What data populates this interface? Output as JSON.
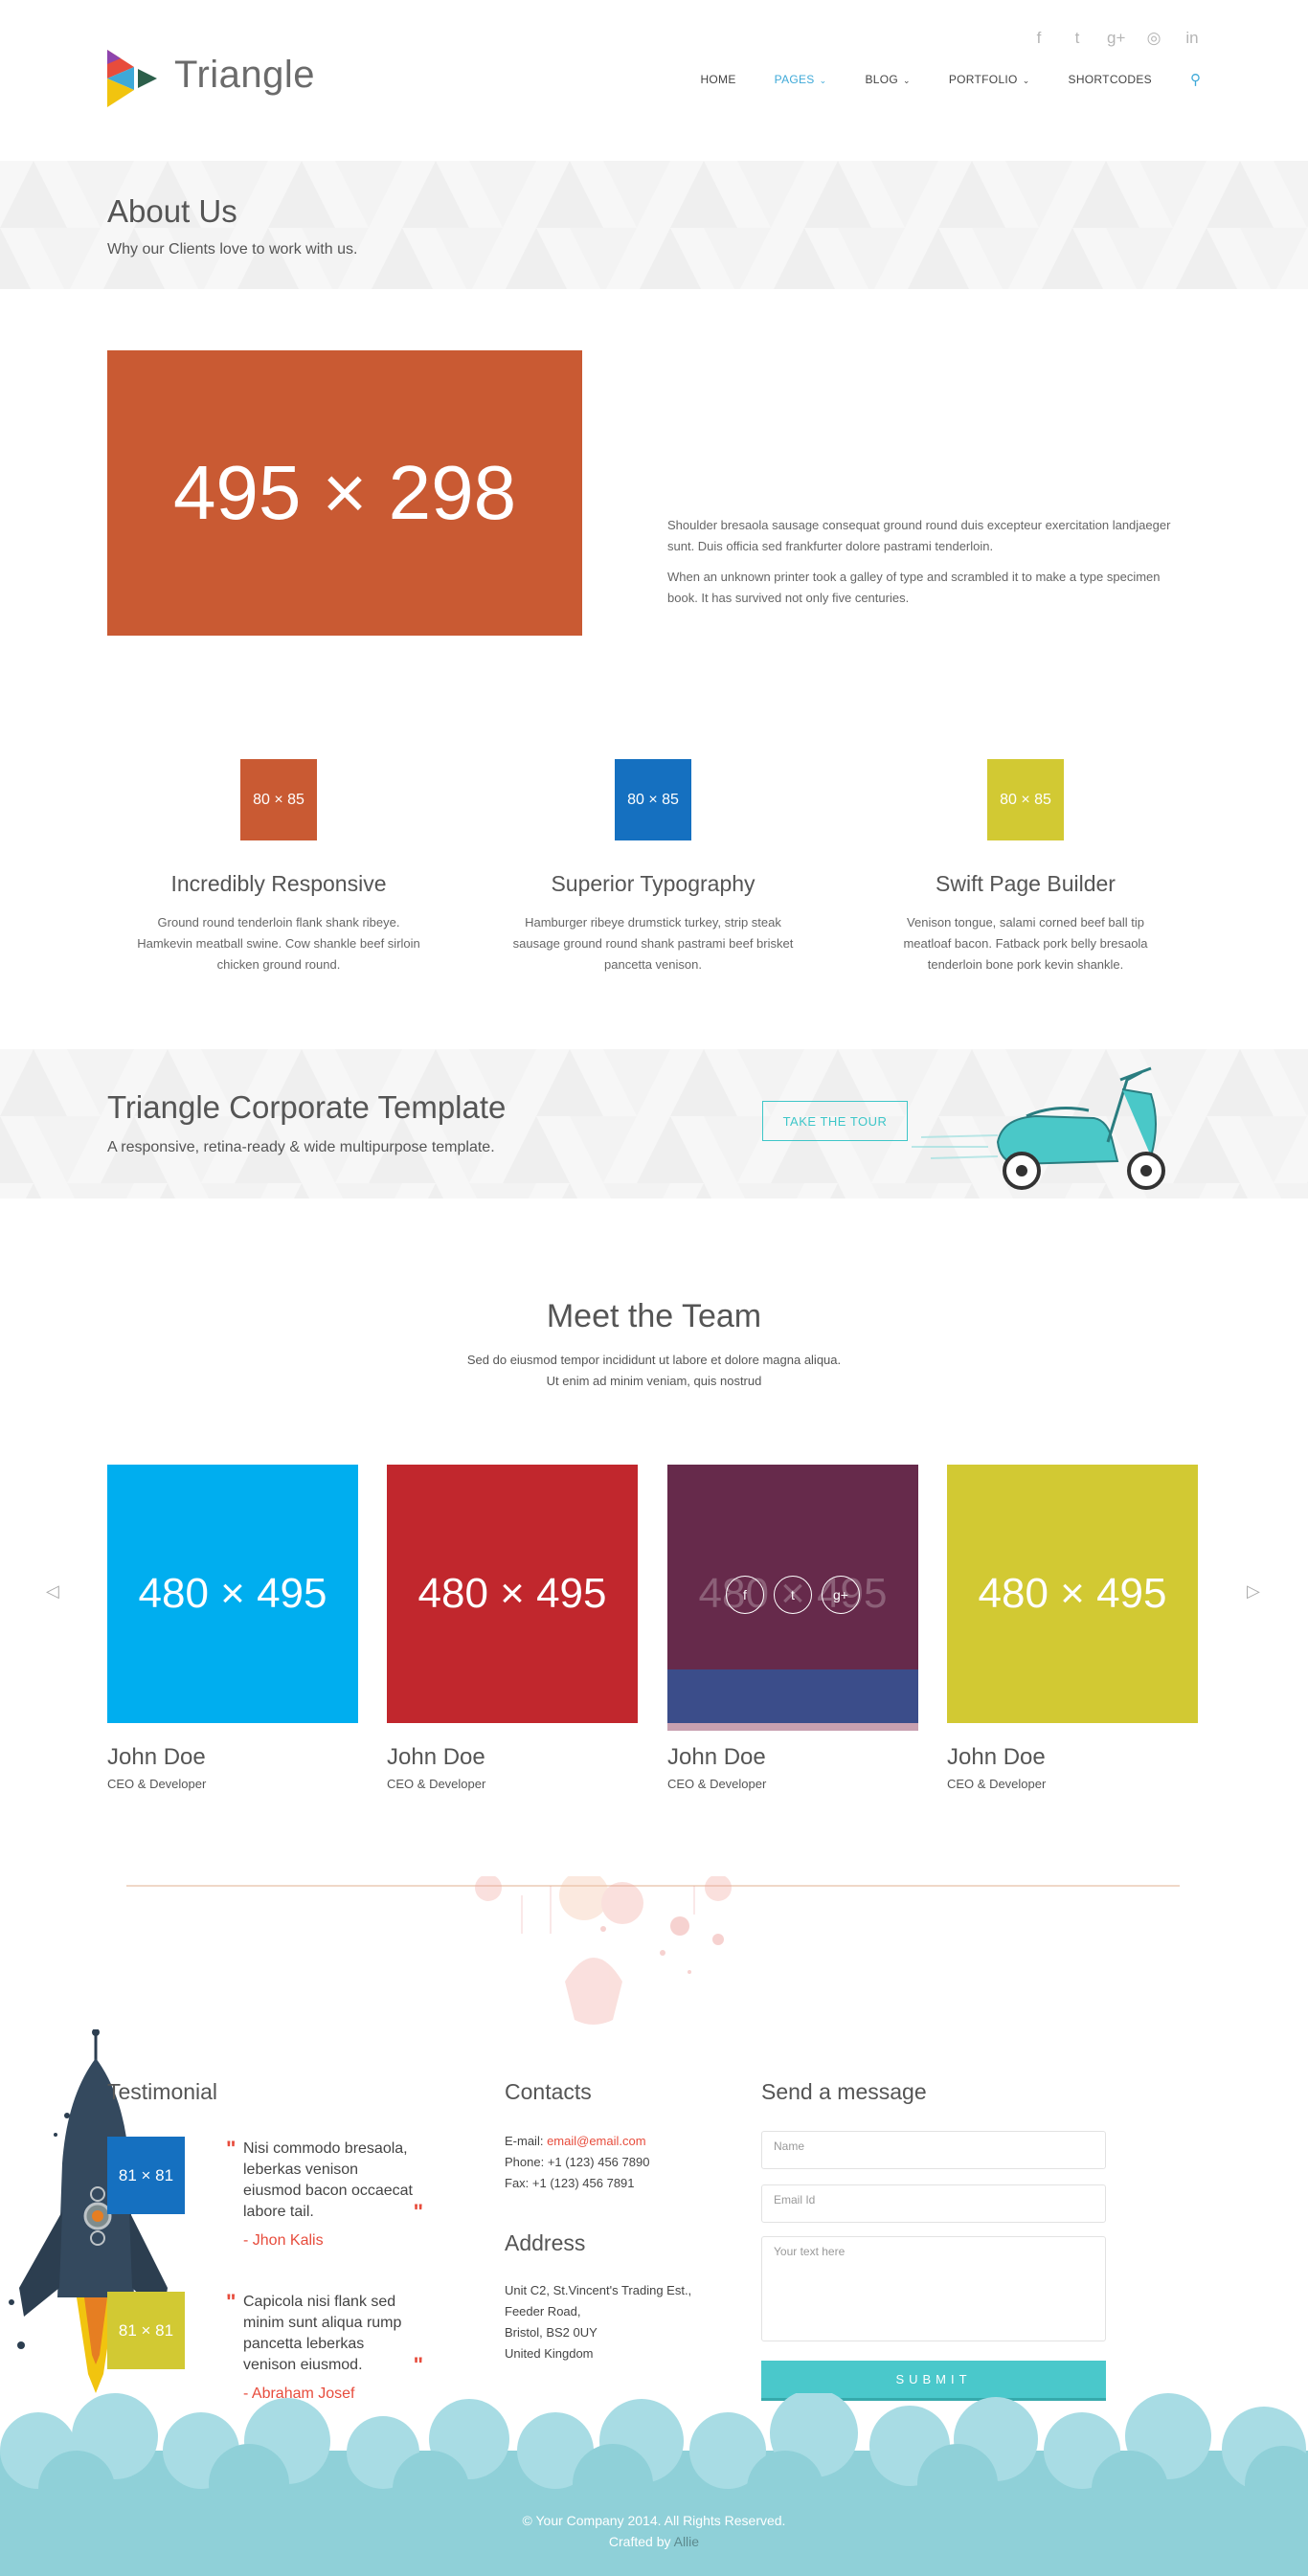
{
  "header": {
    "logo_text": "Triangle",
    "social_icons": [
      "facebook-icon",
      "twitter-icon",
      "google-plus-icon",
      "dribbble-icon",
      "linkedin-icon"
    ],
    "social_glyphs": [
      "f",
      "t",
      "g+",
      "◎",
      "in"
    ],
    "nav": [
      {
        "label": "HOME",
        "active": false,
        "caret": false
      },
      {
        "label": "PAGES",
        "active": true,
        "caret": true
      },
      {
        "label": "BLOG",
        "active": false,
        "caret": true
      },
      {
        "label": "PORTFOLIO",
        "active": false,
        "caret": true
      },
      {
        "label": "SHORTCODES",
        "active": false,
        "caret": false
      }
    ],
    "caret_glyph": "⌄",
    "search_glyph": "⚲"
  },
  "about": {
    "title": "About Us",
    "subtitle": "Why our Clients love to work with us.",
    "image_label": "495 × 298",
    "paragraphs": [
      "Shoulder bresaola sausage consequat ground round duis excepteur exercitation landjaeger sunt. Duis officia sed frankfurter dolore pastrami tenderloin.",
      "When an unknown printer took a galley of type and scrambled it to make a type specimen book. It has survived not only five centuries."
    ]
  },
  "features": [
    {
      "image_label": "80 × 85",
      "color": "#c95a33",
      "title": "Incredibly Responsive",
      "desc": "Ground round tenderloin flank shank ribeye. Hamkevin meatball swine. Cow shankle beef sirloin chicken ground round."
    },
    {
      "image_label": "80 × 85",
      "color": "#1570c0",
      "title": "Superior Typography",
      "desc": "Hamburger ribeye drumstick turkey, strip steak sausage ground round shank pastrami beef brisket pancetta venison."
    },
    {
      "image_label": "80 × 85",
      "color": "#d2c933",
      "title": "Swift Page Builder",
      "desc": "Venison tongue, salami corned beef ball tip meatloaf bacon. Fatback pork belly bresaola tenderloin bone pork kevin shankle."
    }
  ],
  "cta": {
    "title": "Triangle Corporate Template",
    "subtitle": "A responsive, retina-ready & wide multipurpose template.",
    "button": "TAKE THE TOUR"
  },
  "team": {
    "title": "Meet the Team",
    "desc_line1": "Sed do eiusmod tempor incididunt ut labore et dolore magna aliqua.",
    "desc_line2": "Ut enim ad minim veniam, quis nostrud",
    "prev_glyph": "◁",
    "next_glyph": "▷",
    "members": [
      {
        "image_label": "480 × 495",
        "color": "#00aeef",
        "name": "John Doe",
        "role": "CEO & Developer"
      },
      {
        "image_label": "480 × 495",
        "color": "#c1272d",
        "name": "John Doe",
        "role": "CEO & Developer"
      },
      {
        "image_label": "480 × 495",
        "color": "#662a4b",
        "name": "John Doe",
        "role": "CEO & Developer"
      },
      {
        "image_label": "480 × 495",
        "color": "#d2c933",
        "name": "John Doe",
        "role": "CEO & Developer"
      }
    ],
    "hover_social": [
      "f",
      "t",
      "g+"
    ]
  },
  "testimonial": {
    "title": "Testimonial",
    "items": [
      {
        "image_label": "81 × 81",
        "color": "#1570c0",
        "quote": "Nisi commodo bresaola, leberkas venison eiusmod bacon occaecat labore tail.",
        "author": "- Jhon Kalis"
      },
      {
        "image_label": "81 × 81",
        "color": "#d2c933",
        "quote": "Capicola nisi flank sed minim sunt aliqua rump pancetta leberkas venison eiusmod.",
        "author": "- Abraham Josef"
      }
    ]
  },
  "contacts": {
    "title": "Contacts",
    "email_prefix": "E-mail: ",
    "email": "email@email.com",
    "phone": "Phone: +1 (123) 456 7890",
    "fax": "Fax: +1 (123) 456 7891",
    "address_title": "Address",
    "address": [
      "Unit C2, St.Vincent's Trading Est.,",
      "Feeder Road,",
      "Bristol, BS2 0UY",
      "United Kingdom"
    ]
  },
  "message": {
    "title": "Send a message",
    "name_placeholder": "Name",
    "email_placeholder": "Email Id",
    "text_placeholder": "Your text here",
    "submit": "SUBMIT"
  },
  "footer": {
    "copyright": "© Your Company 2014. All Rights Reserved.",
    "crafted_prefix": "Crafted by ",
    "crafter": "Allie"
  }
}
